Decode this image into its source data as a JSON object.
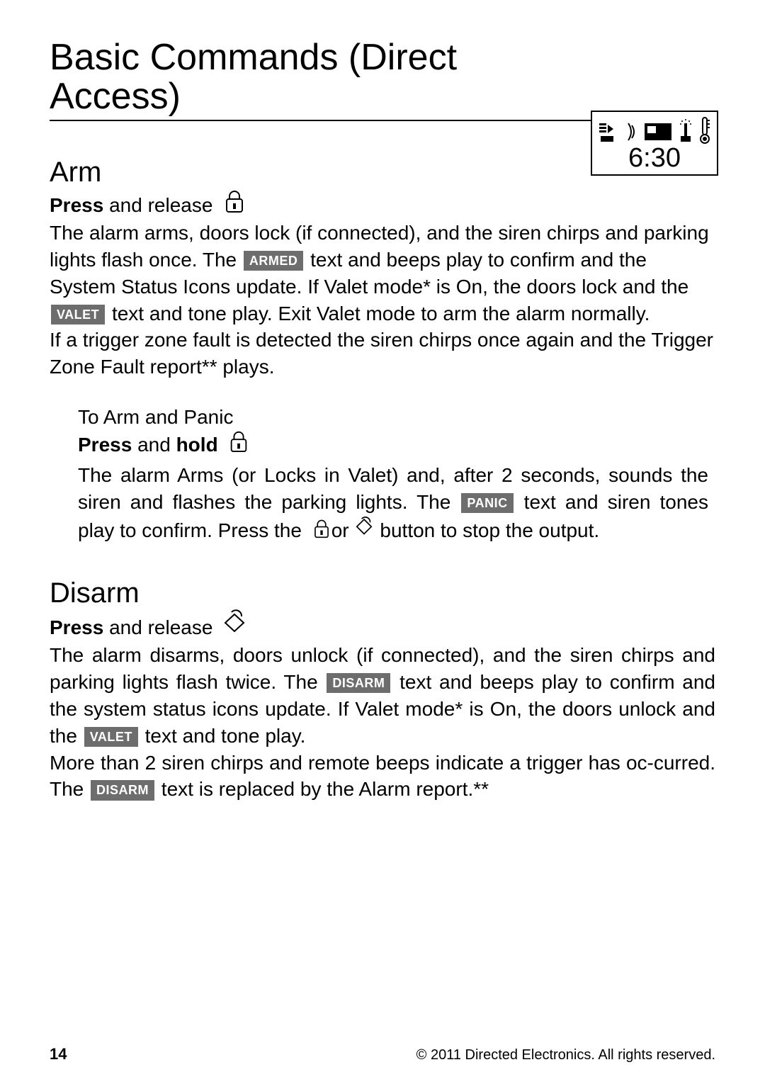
{
  "title": "Basic Commands (Direct Access)",
  "remote": {
    "time": "6:30"
  },
  "arm": {
    "heading": "Arm",
    "press_word": "Press",
    "press_rest": " and release",
    "p1_a": "The alarm arms, doors lock (if connected), and the siren chirps and parking lights flash once. The ",
    "badge_armed": "ARMED",
    "p1_b": " text and beeps play to confirm and the System Status Icons update. If Valet mode* is On, the doors lock and the ",
    "badge_valet": "VALET",
    "p1_c": " text and tone play. Exit Valet mode to arm the alarm normally.",
    "p2": "If a trigger zone fault is detected the siren chirps once again and the Trigger Zone Fault report** plays."
  },
  "arm_panic": {
    "heading": "To Arm and Panic",
    "press_word": "Press",
    "press_mid": " and ",
    "hold_word": "hold",
    "p1_a": "The alarm Arms (or Locks in Valet) and, after 2 seconds, sounds the siren and flashes the parking lights. The ",
    "badge_panic": "PANIC",
    "p1_b": " text and siren tones play to confirm. ",
    "press_inline": "Press",
    "p1_c": " the ",
    "p1_or": "or",
    "p1_d": " button to stop the output."
  },
  "disarm": {
    "heading": "Disarm",
    "press_word": "Press",
    "press_rest": " and release",
    "p1_a": "The alarm disarms, doors unlock (if connected), and the siren chirps and parking lights flash twice. The ",
    "badge_disarm": "DISARM",
    "p1_b": " text and beeps play to confirm and the system status icons update. If Valet mode* is On, the doors unlock and the ",
    "badge_valet": "VALET",
    "p1_c": " text and tone play.",
    "p2_a": "More than 2 siren chirps and remote beeps indicate a trigger has oc-curred. The ",
    "badge_disarm2": "DISARM",
    "p2_b": " text is replaced by the Alarm report.**"
  },
  "footer": {
    "page": "14",
    "copyright": "© 2011 Directed Electronics. All rights reserved."
  }
}
